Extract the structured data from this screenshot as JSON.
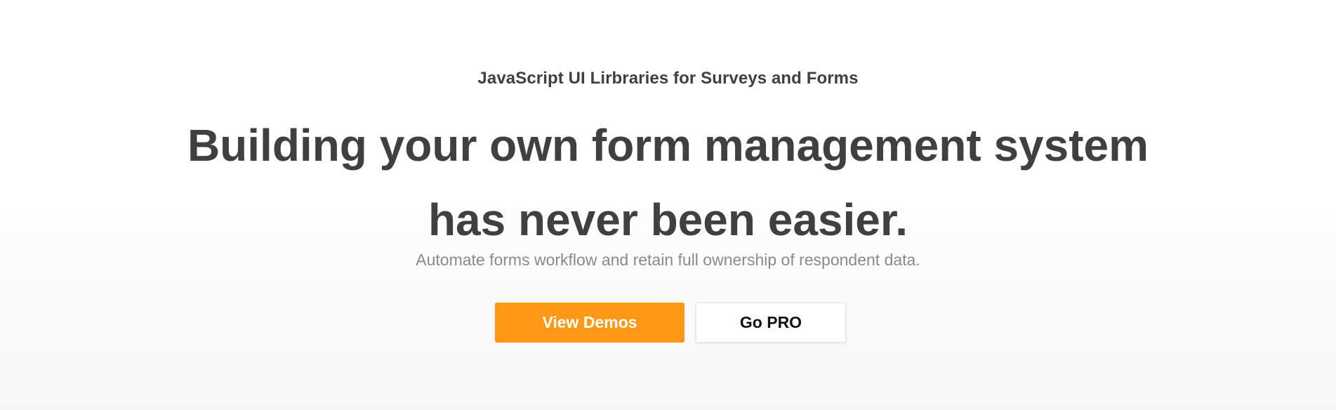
{
  "hero": {
    "eyebrow": "JavaScript UI Lirbraries for Surveys and Forms",
    "headline_line1": "Building your own form management system",
    "headline_line2": "has never been easier.",
    "subtitle": "Automate forms workflow and retain full ownership of respondent data.",
    "primary_button_label": "View Demos",
    "secondary_button_label": "Go PRO"
  },
  "colors": {
    "accent": "#ff9814",
    "heading": "#404040",
    "subtitle": "#8a8a8a",
    "background": "#ffffff"
  }
}
